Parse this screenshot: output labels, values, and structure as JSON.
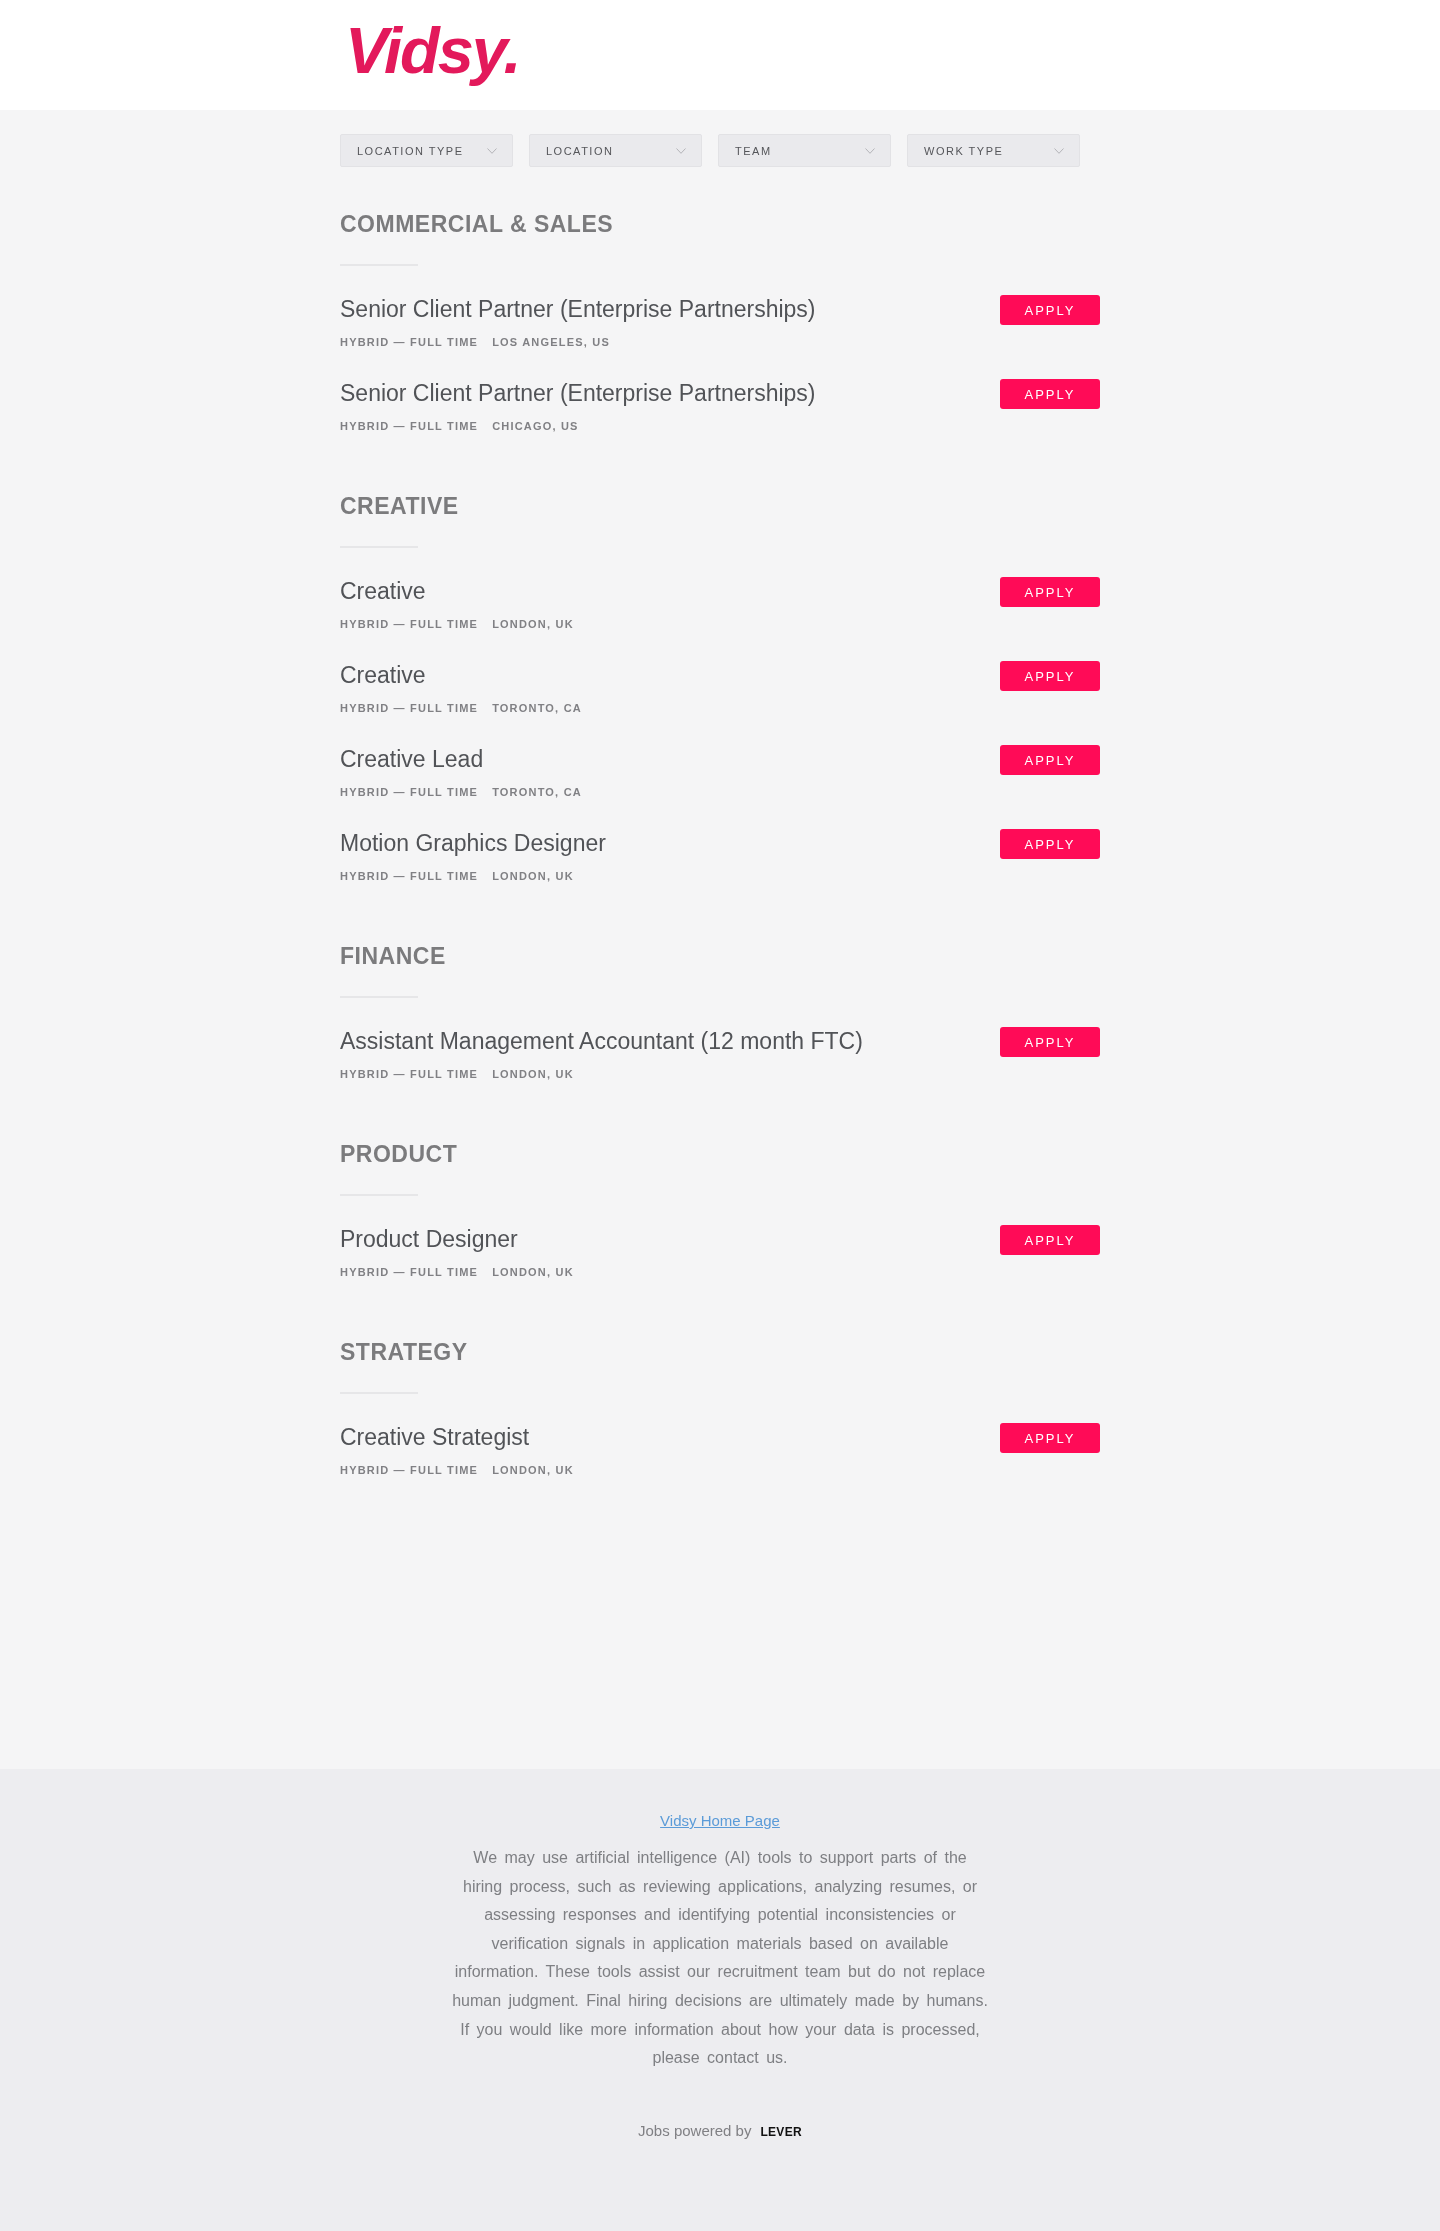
{
  "header": {
    "logo": "Vidsy."
  },
  "filters": [
    {
      "label": "LOCATION TYPE"
    },
    {
      "label": "LOCATION"
    },
    {
      "label": "TEAM"
    },
    {
      "label": "WORK TYPE"
    }
  ],
  "sections": [
    {
      "title": "COMMERCIAL & SALES",
      "jobs": [
        {
          "title": "Senior Client Partner (Enterprise Partnerships)",
          "work_type": "HYBRID — FULL TIME",
          "location": "LOS ANGELES, US",
          "button": "APPLY"
        },
        {
          "title": "Senior Client Partner (Enterprise Partnerships)",
          "work_type": "HYBRID — FULL TIME",
          "location": "CHICAGO, US",
          "button": "APPLY"
        }
      ]
    },
    {
      "title": "CREATIVE",
      "jobs": [
        {
          "title": "Creative",
          "work_type": "HYBRID — FULL TIME",
          "location": "LONDON, UK",
          "button": "APPLY"
        },
        {
          "title": "Creative",
          "work_type": "HYBRID — FULL TIME",
          "location": "TORONTO, CA",
          "button": "APPLY"
        },
        {
          "title": "Creative Lead",
          "work_type": "HYBRID — FULL TIME",
          "location": "TORONTO, CA",
          "button": "APPLY"
        },
        {
          "title": "Motion Graphics Designer",
          "work_type": "HYBRID — FULL TIME",
          "location": "LONDON, UK",
          "button": "APPLY"
        }
      ]
    },
    {
      "title": "FINANCE",
      "jobs": [
        {
          "title": "Assistant Management Accountant (12 month FTC)",
          "work_type": "HYBRID — FULL TIME",
          "location": "LONDON, UK",
          "button": "APPLY"
        }
      ]
    },
    {
      "title": "PRODUCT",
      "jobs": [
        {
          "title": "Product Designer",
          "work_type": "HYBRID — FULL TIME",
          "location": "LONDON, UK",
          "button": "APPLY"
        }
      ]
    },
    {
      "title": "STRATEGY",
      "jobs": [
        {
          "title": "Creative Strategist",
          "work_type": "HYBRID — FULL TIME",
          "location": "LONDON, UK",
          "button": "APPLY"
        }
      ]
    }
  ],
  "footer": {
    "link": "Vidsy Home Page",
    "disclaimer": "We may use artificial intelligence (AI) tools to support parts of the hiring process, such as reviewing applications, analyzing resumes, or assessing responses and identifying potential inconsistencies or verification signals in application materials based on available information. These tools assist our recruitment team but do not replace human judgment. Final hiring decisions are ultimately made by humans. If you would like more information about how your data is processed, please contact us.",
    "powered_by": "Jobs powered by",
    "brand": "LEVER"
  }
}
